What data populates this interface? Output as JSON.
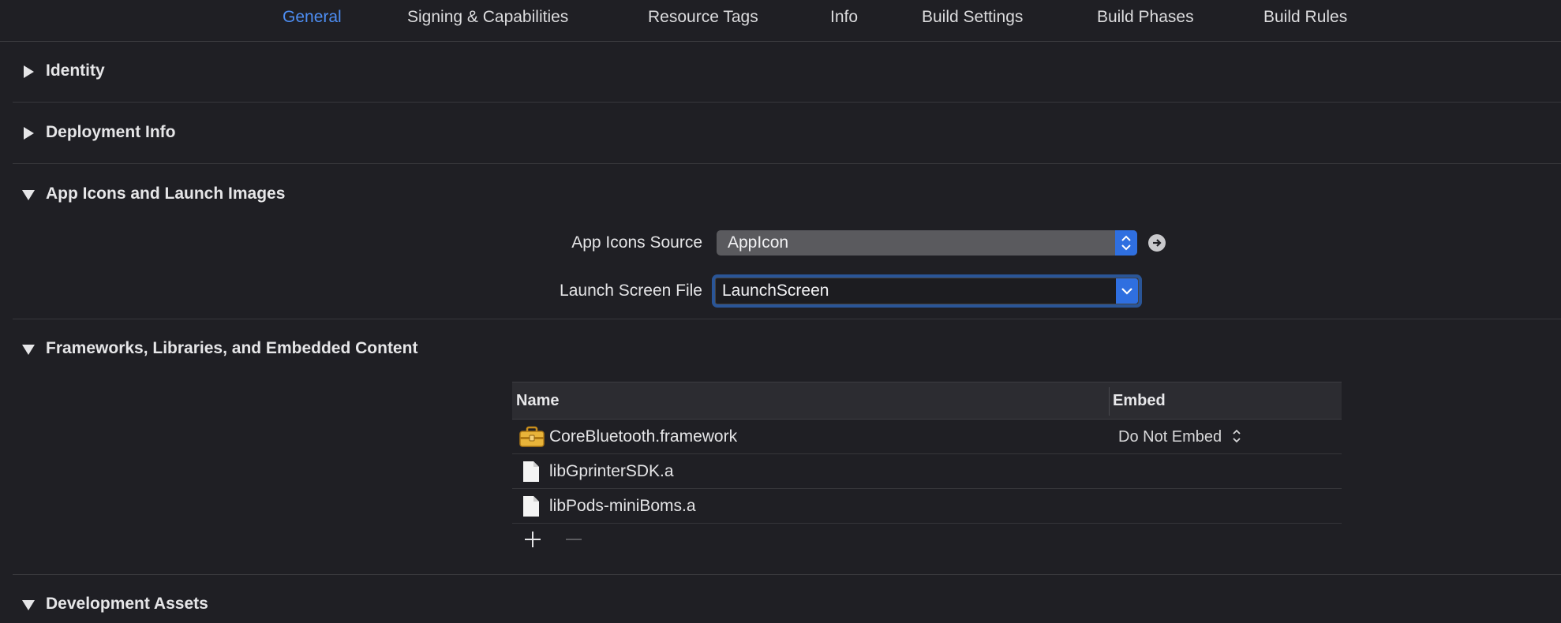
{
  "tabs": [
    {
      "label": "General",
      "active": true
    },
    {
      "label": "Signing & Capabilities",
      "active": false
    },
    {
      "label": "Resource Tags",
      "active": false
    },
    {
      "label": "Info",
      "active": false
    },
    {
      "label": "Build Settings",
      "active": false
    },
    {
      "label": "Build Phases",
      "active": false
    },
    {
      "label": "Build Rules",
      "active": false
    }
  ],
  "sections": {
    "identity": {
      "title": "Identity",
      "expanded": false
    },
    "deployment": {
      "title": "Deployment Info",
      "expanded": false
    },
    "app_icons": {
      "title": "App Icons and Launch Images",
      "expanded": true,
      "app_icons_source_label": "App Icons Source",
      "app_icons_source_value": "AppIcon",
      "launch_screen_label": "Launch Screen File",
      "launch_screen_value": "LaunchScreen"
    },
    "frameworks": {
      "title": "Frameworks, Libraries, and Embedded Content",
      "expanded": true,
      "columns": {
        "name": "Name",
        "embed": "Embed"
      },
      "rows": [
        {
          "name": "CoreBluetooth.framework",
          "embed": "Do Not Embed",
          "icon": "toolbox-icon"
        },
        {
          "name": "libGprinterSDK.a",
          "embed": "",
          "icon": "file-icon"
        },
        {
          "name": "libPods-miniBoms.a",
          "embed": "",
          "icon": "file-icon"
        }
      ],
      "add_label": "+",
      "remove_label": "—"
    },
    "dev_assets": {
      "title": "Development Assets",
      "expanded": true
    }
  },
  "colors": {
    "accent": "#4d8df2",
    "background": "#1f1f24",
    "popup_blue": "#2f6fe0"
  }
}
